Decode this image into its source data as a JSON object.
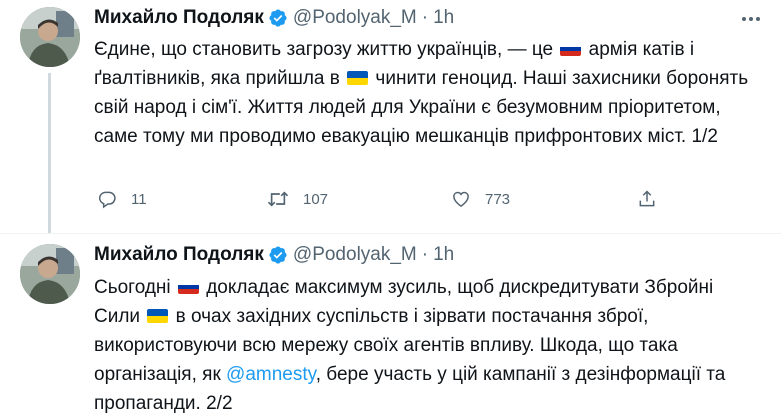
{
  "tweets": [
    {
      "author_name": "Михайло Подоляк",
      "handle": "@Podolyak_M",
      "separator": "·",
      "time": "1h",
      "text_parts": [
        "Єдине, що становить загрозу життю українців, — це ",
        " армія катів і ґвалтівників, яка прийшла в ",
        " чинити геноцид. Наші захисники боронять свій народ і сім'ї. Життя людей для України є безумовним пріоритетом, саме тому ми проводимо евакуацію мешканців прифронтових міст. 1/2"
      ],
      "replies": "11",
      "retweets": "107",
      "likes": "773"
    },
    {
      "author_name": "Михайло Подоляк",
      "handle": "@Podolyak_M",
      "separator": "·",
      "time": "1h",
      "text_parts": [
        "Сьогодні ",
        " докладає максимум зусиль, щоб дискредитувати Збройні Сили ",
        " в очах західних суспільств і зірвати постачання зброї, використовуючи всю мережу своїх агентів впливу. Шкода, що така організація, як ",
        "@amnesty",
        ", бере участь у цій кампанії з дезінформації та пропаганди. 2/2"
      ]
    }
  ],
  "icons": {
    "verified": "verified-badge-icon",
    "more": "more-options-icon",
    "reply": "reply-icon",
    "retweet": "retweet-icon",
    "like": "heart-icon",
    "share": "share-icon",
    "flag_russia": "russia-flag-emoji",
    "flag_ukraine": "ukraine-flag-emoji"
  },
  "colors": {
    "text": "#0f1419",
    "secondary": "#536471",
    "accent": "#1d9bf0",
    "thread_line": "#cfd9de",
    "divider": "#eff3f4"
  }
}
